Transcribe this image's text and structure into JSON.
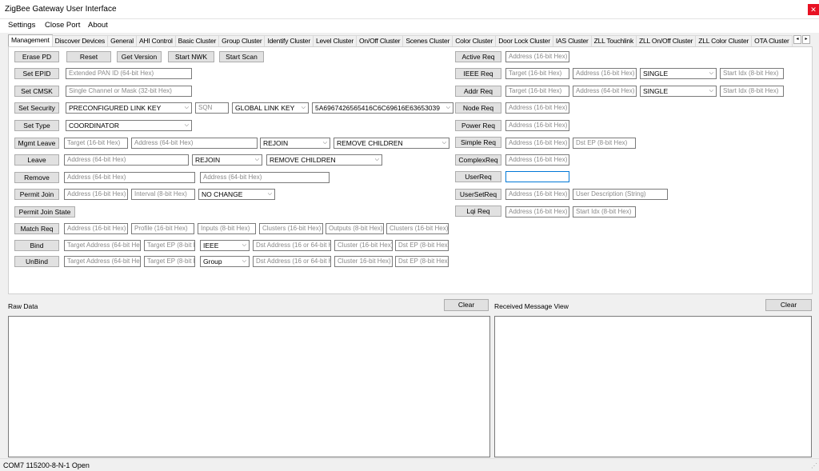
{
  "window": {
    "title": "ZigBee Gateway User Interface",
    "close_icon": "close-icon"
  },
  "menu": [
    "Settings",
    "Close Port",
    "About"
  ],
  "tabs": [
    "Management",
    "Discover Devices",
    "General",
    "AHI Control",
    "Basic Cluster",
    "Group Cluster",
    "Identify Cluster",
    "Level Cluster",
    "On/Off Cluster",
    "Scenes Cluster",
    "Color Cluster",
    "Door Lock Cluster",
    "IAS Cluster",
    "ZLL Touchlink",
    "ZLL On/Off Cluster",
    "ZLL Color Cluster",
    "OTA Cluster"
  ],
  "tab_scroll": {
    "left": "◂",
    "right": "▸"
  },
  "left": {
    "erase_pd": "Erase PD",
    "reset": "Reset",
    "get_version": "Get Version",
    "start_nwk": "Start NWK",
    "start_scan": "Start Scan",
    "set_epid": "Set EPID",
    "epid_ph": "Extended PAN ID (64-bit Hex)",
    "set_cmsk": "Set CMSK",
    "cmsk_ph": "Single Channel or Mask (32-bit Hex)",
    "set_security": "Set Security",
    "sec_key_type": "PRECONFIGURED LINK KEY",
    "sqn_ph": "SQN",
    "sec_key_mode": "GLOBAL LINK KEY",
    "sec_key_value": "5A6967426565416C6C69616E63653039",
    "set_type": "Set Type",
    "type_value": "COORDINATOR",
    "mgmt_leave": "Mgmt Leave",
    "ml_target_ph": "Target (16-bit Hex)",
    "ml_addr_ph": "Address (64-bit Hex)",
    "ml_rejoin": "REJOIN",
    "ml_remove_children": "REMOVE CHILDREN",
    "leave": "Leave",
    "lv_addr_ph": "Address (64-bit Hex)",
    "lv_rejoin": "REJOIN",
    "lv_remove_children": "REMOVE CHILDREN",
    "remove": "Remove",
    "rm_addr1_ph": "Address (64-bit Hex)",
    "rm_addr2_ph": "Address (64-bit Hex)",
    "permit_join": "Permit Join",
    "pj_addr_ph": "Address (16-bit Hex)",
    "pj_interval_ph": "Interval (8-bit Hex)",
    "pj_change": "NO CHANGE",
    "permit_join_state": "Permit Join State",
    "match_req": "Match Req",
    "mr_addr_ph": "Address (16-bit Hex)",
    "mr_profile_ph": "Profile (16-bit Hex)",
    "mr_inputs_ph": "Inputs (8-bit Hex)",
    "mr_in_clusters_ph": "Clusters (16-bit Hex)",
    "mr_outputs_ph": "Outputs (8-bit Hex)",
    "mr_out_clusters_ph": "Clusters (16-bit Hex)",
    "bind": "Bind",
    "bd_target_addr_ph": "Target Address (64-bit Hex)",
    "bd_target_ep_ph": "Target EP (8-bit Hex)",
    "bd_mode": "IEEE",
    "bd_dst_addr_ph": "Dst Address (16 or 64-bit Hex)",
    "bd_cluster_ph": "Cluster (16-bit Hex)",
    "bd_dst_ep_ph": "Dst EP (8-bit Hex)",
    "unbind": "UnBind",
    "ub_target_addr_ph": "Target Address (64-bit Hex)",
    "ub_target_ep_ph": "Target EP (8-bit Hex)",
    "ub_mode": "Group",
    "ub_dst_addr_ph": "Dst Address (16 or 64-bit Hex)",
    "ub_cluster_ph": "Cluster 16-bit Hex)",
    "ub_dst_ep_ph": "Dst EP (8-bit Hex)"
  },
  "right": {
    "active_req": "Active Req",
    "ar_addr_ph": "Address (16-bit Hex)",
    "ieee_req": "IEEE Req",
    "ir_target_ph": "Target (16-bit Hex)",
    "ir_addr_ph": "Address (16-bit Hex)",
    "ir_mode": "SINGLE",
    "ir_start_ph": "Start Idx (8-bit Hex)",
    "addr_req": "Addr Req",
    "adr_target_ph": "Target (16-bit Hex)",
    "adr_addr_ph": "Address (64-bit Hex)",
    "adr_mode": "SINGLE",
    "adr_start_ph": "Start Idx (8-bit Hex)",
    "node_req": "Node Req",
    "nr_addr_ph": "Address (16-bit Hex)",
    "power_req": "Power Req",
    "pr_addr_ph": "Address (16-bit Hex)",
    "simple_req": "Simple Req",
    "sr_addr_ph": "Address (16-bit Hex)",
    "sr_ep_ph": "Dst EP (8-bit Hex)",
    "complex_req": "ComplexReq",
    "cr_addr_ph": "Address (16-bit Hex)",
    "user_req": "UserReq",
    "ur_value": "",
    "user_set_req": "UserSetReq",
    "usr_addr_ph": "Address (16-bit Hex)",
    "usr_desc_ph": "User Description (String)",
    "lqi_req": "Lqi Req",
    "lq_addr_ph": "Address (16-bit Hex)",
    "lq_start_ph": "Start Idx (8-bit Hex)"
  },
  "raw_data": {
    "label": "Raw Data",
    "clear": "Clear"
  },
  "received": {
    "label": "Received Message View",
    "clear": "Clear"
  },
  "status": {
    "text": "COM7 115200-8-N-1 Open"
  }
}
